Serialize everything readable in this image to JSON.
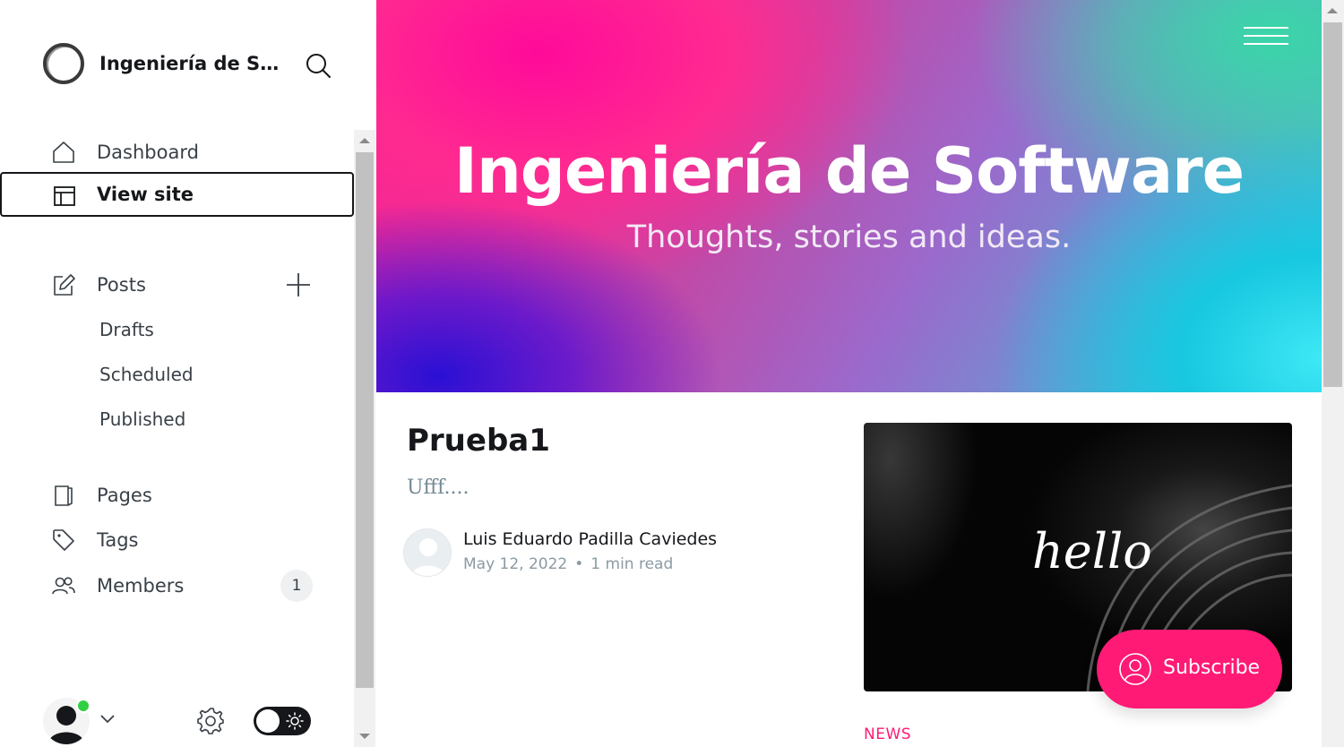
{
  "sidebar": {
    "site_title": "Ingeniería de Software",
    "nav": {
      "dashboard": "Dashboard",
      "view_site": "View site",
      "posts": "Posts",
      "drafts": "Drafts",
      "scheduled": "Scheduled",
      "published": "Published",
      "pages": "Pages",
      "tags": "Tags",
      "members": "Members",
      "members_count": "1"
    }
  },
  "site": {
    "title": "Ingeniería de Software",
    "description": "Thoughts, stories and ideas.",
    "post": {
      "title": "Prueba1",
      "excerpt": "Ufff....",
      "author": "Luis Eduardo Padilla Caviedes",
      "date": "May 12, 2022",
      "separator": "•",
      "reading_time": "1 min read"
    },
    "feature_image_text": "hello",
    "next_tag": "NEWS",
    "subscribe_label": "Subscribe"
  },
  "colors": {
    "accent": "#ff1a75",
    "online_status": "#30cf43"
  }
}
